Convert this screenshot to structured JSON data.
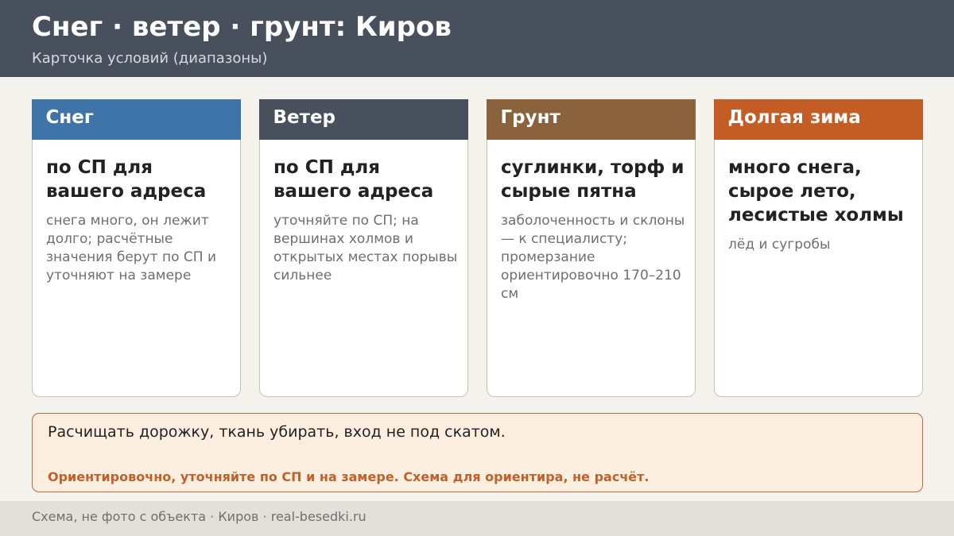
{
  "header": {
    "title": "Снег · ветер · грунт: Киров",
    "subtitle": "Карточка условий (диапазоны)",
    "background": "#47505c"
  },
  "cards": [
    {
      "heading": "Снег",
      "color": "#3e74a8",
      "main": "по СП для вашего адреса",
      "note": "снега много, он лежит долго; расчётные значения берут по СП и уточняют на замере"
    },
    {
      "heading": "Ветер",
      "color": "#47505c",
      "main": "по СП для вашего адреса",
      "note": "уточняйте по СП; на вершинах холмов и открытых местах порывы сильнее"
    },
    {
      "heading": "Грунт",
      "color": "#8a623b",
      "main": "суглинки, торф и сырые пятна",
      "note": "заболоченность и склоны — к специалисту; промерзание ориентировочно 170–210 см"
    },
    {
      "heading": "Долгая зима",
      "color": "#c45c26",
      "main": "много снега, сырое лето, лесистые холмы",
      "note": "лёд и сугробы"
    }
  ],
  "callout": {
    "text": "Расчищать дорожку, ткань убирать, вход не под скатом.",
    "warning": "Ориентировочно, уточняйте по СП и на замере. Схема для ориентира, не расчёт.",
    "warning_color": "#c0612c"
  },
  "footer": {
    "text": "Схема, не фото с объекта  ·  Киров  ·  real-besedki.ru"
  }
}
